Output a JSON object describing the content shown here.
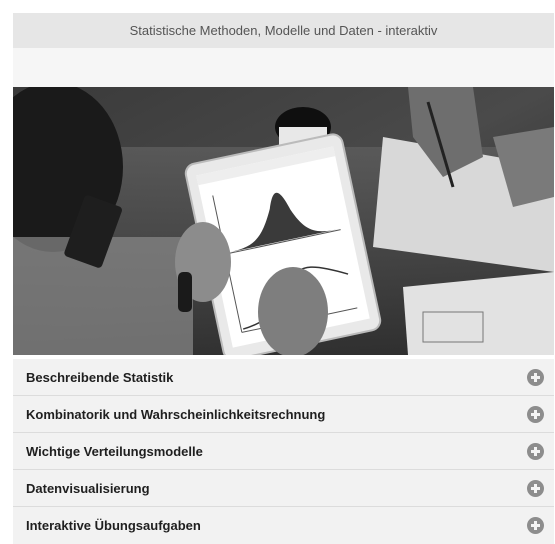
{
  "header": {
    "title": "Statistische Methoden, Modelle und Daten - interaktiv"
  },
  "hero": {
    "icon": "hero-photo-tablet-statistics"
  },
  "accordion": {
    "items": [
      {
        "label": "Beschreibende Statistik",
        "icon": "plus-circle-icon"
      },
      {
        "label": "Kombinatorik und Wahrscheinlichkeitsrechnung",
        "icon": "plus-circle-icon"
      },
      {
        "label": "Wichtige Verteilungsmodelle",
        "icon": "plus-circle-icon"
      },
      {
        "label": "Datenvisualisierung",
        "icon": "plus-circle-icon"
      },
      {
        "label": "Interaktive Übungsaufgaben",
        "icon": "plus-circle-icon"
      }
    ]
  }
}
